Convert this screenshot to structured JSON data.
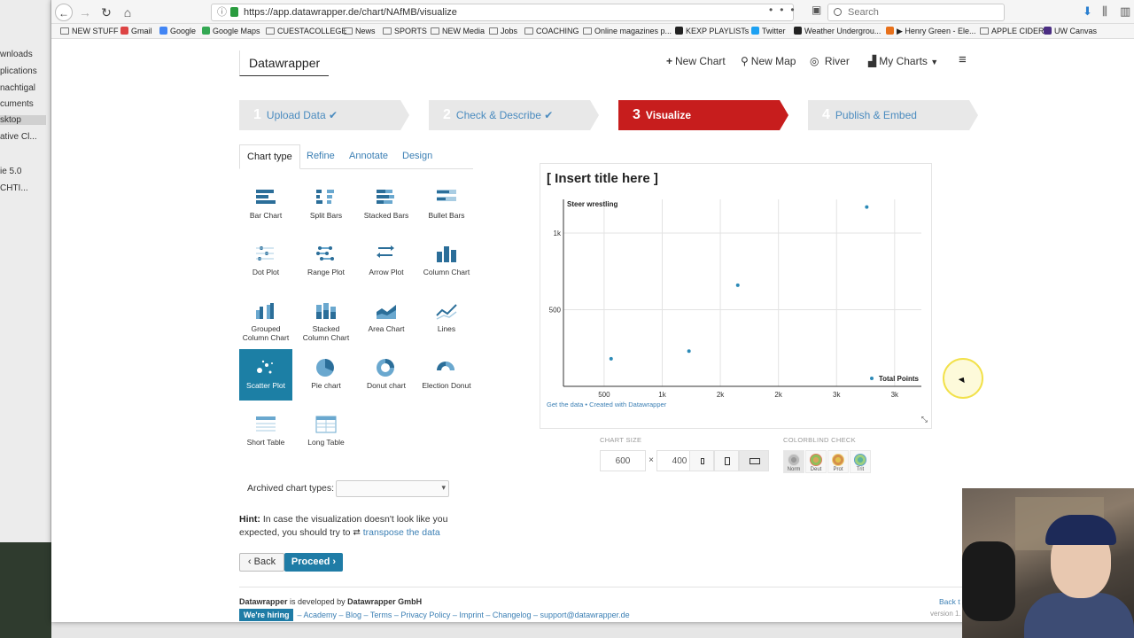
{
  "browser": {
    "url": "https://app.datawrapper.de/chart/NAfMB/visualize",
    "search_placeholder": "Search",
    "bookmarks": [
      "NEW STUFF",
      "Gmail",
      "Google",
      "Google Maps",
      "CUESTACOLLEGE",
      "News",
      "SPORTS",
      "NEW Media",
      "Jobs",
      "COACHING",
      "Online magazines p...",
      "KEXP PLAYLISTs",
      "Twitter",
      "Weather Undergrou...",
      "▶ Henry Green - Ele...",
      "APPLE CIDER",
      "UW Canvas"
    ]
  },
  "finder": {
    "items": [
      "wnloads",
      "plications",
      "nachtigal",
      "cuments",
      "sktop",
      "ative Cl...",
      "ie 5.0",
      "CHTI..."
    ]
  },
  "app": {
    "logo": "Datawrapper",
    "nav": {
      "new_chart": "New Chart",
      "new_map": "New Map",
      "river": "River",
      "my_charts": "My Charts"
    },
    "steps": [
      {
        "num": "1",
        "label": "Upload Data ✔"
      },
      {
        "num": "2",
        "label": "Check & Describe ✔"
      },
      {
        "num": "3",
        "label": "Visualize"
      },
      {
        "num": "4",
        "label": "Publish & Embed"
      }
    ],
    "tabs": [
      "Chart type",
      "Refine",
      "Annotate",
      "Design"
    ],
    "chart_types": [
      {
        "label": "Bar Chart",
        "icon": "bar-chart-icon"
      },
      {
        "label": "Split Bars",
        "icon": "split-bars-icon"
      },
      {
        "label": "Stacked Bars",
        "icon": "stacked-bars-icon"
      },
      {
        "label": "Bullet Bars",
        "icon": "bullet-bars-icon"
      },
      {
        "label": "Dot Plot",
        "icon": "dot-plot-icon"
      },
      {
        "label": "Range Plot",
        "icon": "range-plot-icon"
      },
      {
        "label": "Arrow Plot",
        "icon": "arrow-plot-icon"
      },
      {
        "label": "Column Chart",
        "icon": "column-chart-icon"
      },
      {
        "label": "Grouped Column Chart",
        "icon": "grouped-column-icon"
      },
      {
        "label": "Stacked Column Chart",
        "icon": "stacked-column-icon"
      },
      {
        "label": "Area Chart",
        "icon": "area-chart-icon"
      },
      {
        "label": "Lines",
        "icon": "lines-icon"
      },
      {
        "label": "Scatter Plot",
        "icon": "scatter-plot-icon"
      },
      {
        "label": "Pie chart",
        "icon": "pie-chart-icon"
      },
      {
        "label": "Donut chart",
        "icon": "donut-chart-icon"
      },
      {
        "label": "Election Donut",
        "icon": "election-donut-icon"
      },
      {
        "label": "Short Table",
        "icon": "short-table-icon"
      },
      {
        "label": "Long Table",
        "icon": "long-table-icon"
      }
    ],
    "archived_label": "Archived chart types:",
    "hint": {
      "bold": "Hint:",
      "text": "In case the visualization doesn't look like you expected, you should try to",
      "link": "transpose the data"
    },
    "back_label": "Back",
    "proceed_label": "Proceed",
    "footer": {
      "line1_pre": "Datawrapper",
      "line1_mid": "is developed by",
      "line1_org": "Datawrapper GmbH",
      "hiring": "We're hiring",
      "links": "– Academy – Blog – Terms – Privacy Policy – Imprint – Changelog – support@datawrapper.de",
      "right": "Back t",
      "version": "version 1."
    },
    "chart_size": {
      "label": "CHART SIZE",
      "width": "600",
      "times": "×",
      "height": "400"
    },
    "colorblind": {
      "label": "COLORBLIND CHECK",
      "options": [
        "Norm",
        "Deut",
        "Prot",
        "Trit"
      ]
    }
  },
  "preview": {
    "title": "[ Insert title here ]",
    "credit": "Get the data • Created with Datawrapper"
  },
  "chart_data": {
    "type": "scatter",
    "title": "[ Insert title here ]",
    "xlabel": "Total Points",
    "ylabel": "Steer wrestling",
    "x_ticks": [
      "500",
      "1k",
      "2k",
      "2k",
      "3k",
      "3k"
    ],
    "y_ticks": [
      "500",
      "1k"
    ],
    "x_tick_values": [
      500,
      1000,
      1500,
      2000,
      2500,
      3000
    ],
    "y_tick_values": [
      500,
      1000
    ],
    "xlim": [
      150,
      3230
    ],
    "ylim": [
      0,
      1220
    ],
    "points": [
      {
        "x": 560,
        "y": 180
      },
      {
        "x": 1230,
        "y": 230
      },
      {
        "x": 1650,
        "y": 660
      },
      {
        "x": 2760,
        "y": 1170
      }
    ],
    "color": "#2c8ab7"
  }
}
